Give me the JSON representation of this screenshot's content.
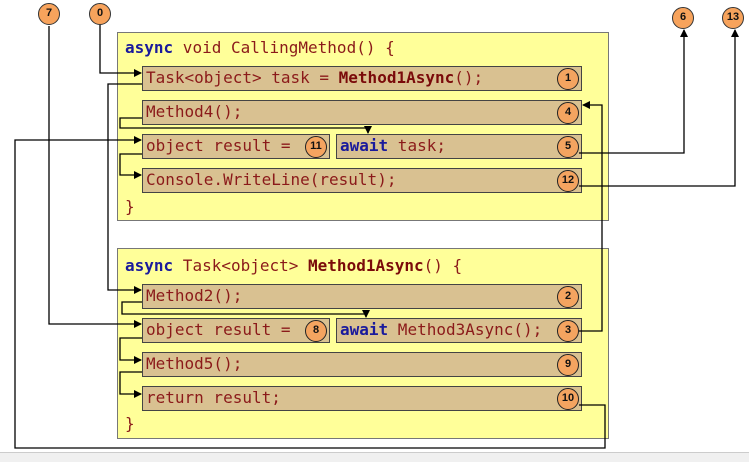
{
  "outer_badges": {
    "b7": "7",
    "b0": "0",
    "b6": "6",
    "b13": "13"
  },
  "calling": {
    "header_kw": "async",
    "header_rest": " void CallingMethod() {",
    "stmt1": "Task<object> task = ",
    "stmt1_bold": "Method1Async",
    "stmt1_tail": "();",
    "stmt4": "Method4();",
    "stmt11": "object result =",
    "stmt5_kw": "await",
    "stmt5_rest": " task;",
    "stmt12": "Console.WriteLine(result);",
    "close": "}",
    "badges": {
      "b1": "1",
      "b4": "4",
      "b11": "11",
      "b5": "5",
      "b12": "12"
    }
  },
  "method1": {
    "header_kw": "async",
    "header_mid": " Task<object> ",
    "header_bold": "Method1Async",
    "header_tail": "() {",
    "stmt2": "Method2();",
    "stmt8": "object result =",
    "stmt3_kw": "await",
    "stmt3_rest": " Method3Async();",
    "stmt9": "Method5();",
    "stmt10": "return result;",
    "close": "}",
    "badges": {
      "b2": "2",
      "b8": "8",
      "b3": "3",
      "b9": "9",
      "b10": "10"
    }
  }
}
